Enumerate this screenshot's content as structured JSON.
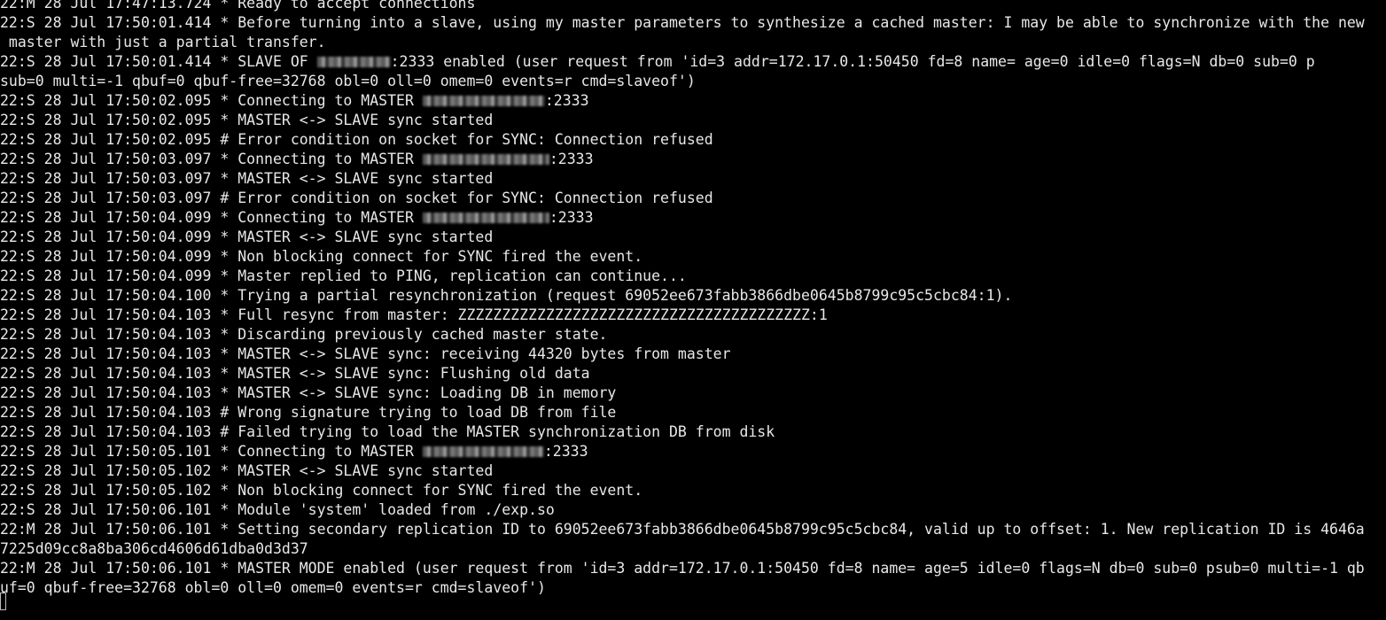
{
  "terminal": {
    "lines": [
      {
        "text": "22:M 28 Jul 17:47:13.724 * Ready to accept connections"
      },
      {
        "text": "22:S 28 Jul 17:50:01.414 * Before turning into a slave, using my master parameters to synthesize a cached master: I may be able to synchronize with the new"
      },
      {
        "text": " master with just a partial transfer."
      },
      {
        "pre": "22:S 28 Jul 17:50:01.414 * SLAVE OF ",
        "redacted": "master-host",
        "post": ":2333 enabled (user request from 'id=3 addr=172.17.0.1:50450 fd=8 name= age=0 idle=0 flags=N db=0 sub=0 p"
      },
      {
        "text": "sub=0 multi=-1 qbuf=0 qbuf-free=32768 obl=0 oll=0 omem=0 events=r cmd=slaveof')"
      },
      {
        "pre": "22:S 28 Jul 17:50:02.095 * Connecting to MASTER ",
        "redacted": "master-host",
        "post": ":2333"
      },
      {
        "text": "22:S 28 Jul 17:50:02.095 * MASTER <-> SLAVE sync started"
      },
      {
        "text": "22:S 28 Jul 17:50:02.095 # Error condition on socket for SYNC: Connection refused"
      },
      {
        "pre": "22:S 28 Jul 17:50:03.097 * Connecting to MASTER ",
        "redacted": "master-host",
        "post": ":2333"
      },
      {
        "text": "22:S 28 Jul 17:50:03.097 * MASTER <-> SLAVE sync started"
      },
      {
        "text": "22:S 28 Jul 17:50:03.097 # Error condition on socket for SYNC: Connection refused"
      },
      {
        "pre": "22:S 28 Jul 17:50:04.099 * Connecting to MASTER ",
        "redacted": "master-host",
        "post": ":2333"
      },
      {
        "text": "22:S 28 Jul 17:50:04.099 * MASTER <-> SLAVE sync started"
      },
      {
        "text": "22:S 28 Jul 17:50:04.099 * Non blocking connect for SYNC fired the event."
      },
      {
        "text": "22:S 28 Jul 17:50:04.099 * Master replied to PING, replication can continue..."
      },
      {
        "text": "22:S 28 Jul 17:50:04.100 * Trying a partial resynchronization (request 69052ee673fabb3866dbe0645b8799c95c5cbc84:1)."
      },
      {
        "text": "22:S 28 Jul 17:50:04.103 * Full resync from master: ZZZZZZZZZZZZZZZZZZZZZZZZZZZZZZZZZZZZZZZZ:1"
      },
      {
        "text": "22:S 28 Jul 17:50:04.103 * Discarding previously cached master state."
      },
      {
        "text": "22:S 28 Jul 17:50:04.103 * MASTER <-> SLAVE sync: receiving 44320 bytes from master"
      },
      {
        "text": "22:S 28 Jul 17:50:04.103 * MASTER <-> SLAVE sync: Flushing old data"
      },
      {
        "text": "22:S 28 Jul 17:50:04.103 * MASTER <-> SLAVE sync: Loading DB in memory"
      },
      {
        "text": "22:S 28 Jul 17:50:04.103 # Wrong signature trying to load DB from file"
      },
      {
        "text": "22:S 28 Jul 17:50:04.103 # Failed trying to load the MASTER synchronization DB from disk"
      },
      {
        "pre": "22:S 28 Jul 17:50:05.101 * Connecting to MASTER ",
        "redacted": "master-host",
        "post": ":2333"
      },
      {
        "text": "22:S 28 Jul 17:50:05.102 * MASTER <-> SLAVE sync started"
      },
      {
        "text": "22:S 28 Jul 17:50:05.102 * Non blocking connect for SYNC fired the event."
      },
      {
        "text": "22:S 28 Jul 17:50:06.101 * Module 'system' loaded from ./exp.so"
      },
      {
        "text": "22:M 28 Jul 17:50:06.101 * Setting secondary replication ID to 69052ee673fabb3866dbe0645b8799c95c5cbc84, valid up to offset: 1. New replication ID is 4646a"
      },
      {
        "text": "7225d09cc8a8ba306cd4606d61dba0d3d37"
      },
      {
        "text": "22:M 28 Jul 17:50:06.101 * MASTER MODE enabled (user request from 'id=3 addr=172.17.0.1:50450 fd=8 name= age=5 idle=0 flags=N db=0 sub=0 psub=0 multi=-1 qb"
      },
      {
        "text": "uf=0 qbuf-free=32768 obl=0 oll=0 omem=0 events=r cmd=slaveof')"
      }
    ]
  },
  "colors": {
    "background": "#000000",
    "foreground": "#e8e8e8"
  }
}
